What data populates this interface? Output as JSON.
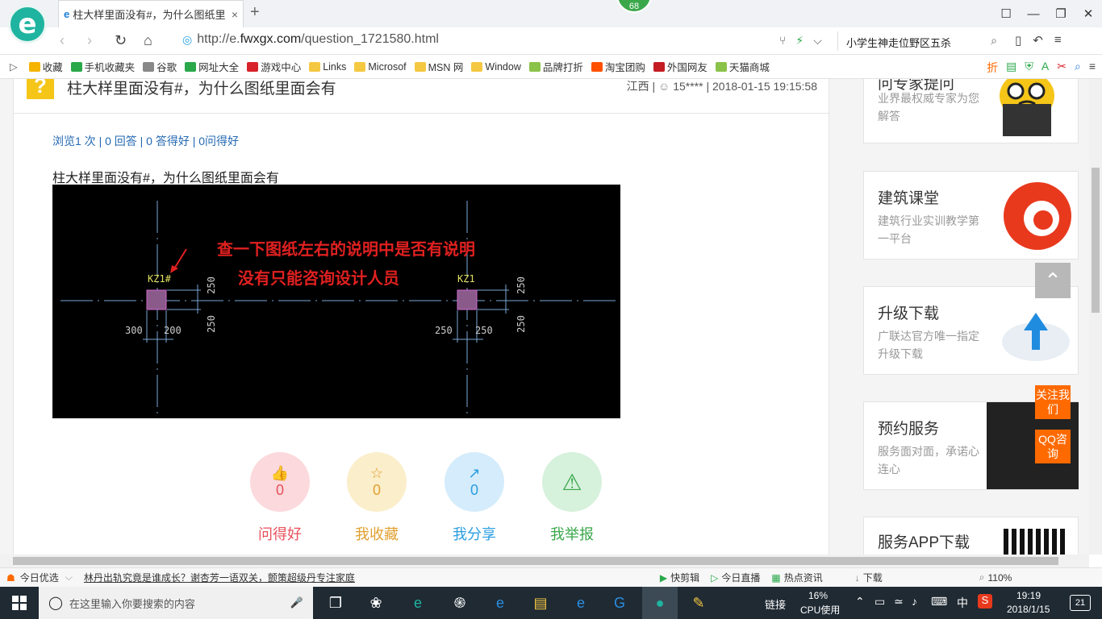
{
  "browser": {
    "tab_title": "柱大样里面没有#，为什么图纸里",
    "tab_close": "×",
    "new_tab": "+",
    "badge": "68",
    "url_prefix": "http://e.",
    "url_domain": "fwxgx.com",
    "url_path": "/question_1721580.html",
    "search_text": "小学生神走位野区五杀",
    "window_controls": [
      "☐",
      "—",
      "❐",
      "✕"
    ]
  },
  "bookmarks": [
    {
      "label": "收藏",
      "color": "#f5b400"
    },
    {
      "label": "手机收藏夹",
      "color": "#2aa84a"
    },
    {
      "label": "谷歌",
      "color": "#888888"
    },
    {
      "label": "网址大全",
      "color": "#2aa84a"
    },
    {
      "label": "游戏中心",
      "color": "#d8232a"
    },
    {
      "label": "Links",
      "color": "#f5c842"
    },
    {
      "label": "Microsof",
      "color": "#f5c842"
    },
    {
      "label": "MSN 网",
      "color": "#f5c842"
    },
    {
      "label": "Window",
      "color": "#f5c842"
    },
    {
      "label": "品牌打折",
      "color": "#8bc34a"
    },
    {
      "label": "淘宝团购",
      "color": "#ff5000"
    },
    {
      "label": "外国网友",
      "color": "#c41d23"
    },
    {
      "label": "天猫商城",
      "color": "#8bc34a"
    }
  ],
  "question": {
    "icon": "?",
    "title": "柱大样里面没有#，为什么图纸里面会有",
    "meta_region": "江西",
    "meta_user": "15****",
    "meta_time": "2018-01-15 19:15:58",
    "stats": "浏览1 次 | 0 回答 | 0 答得好 | 0问得好",
    "body": "柱大样里面没有#，为什么图纸里面会有"
  },
  "drawing": {
    "note_line1": "查一下图纸左右的说明中是否有说明",
    "note_line2": "没有只能咨询设计人员",
    "label_left": "KZ1#",
    "label_right": "KZ1",
    "dim_300": "300",
    "dim_200": "200",
    "dim_250": "250"
  },
  "actions": [
    {
      "label": "问得好",
      "count": "0",
      "color": "#e8505b",
      "bg": "#fbd9dc",
      "icon": "👍"
    },
    {
      "label": "我收藏",
      "count": "0",
      "color": "#e0a030",
      "bg": "#fbeecb",
      "icon": "☆"
    },
    {
      "label": "我分享",
      "count": "0",
      "color": "#2a9ee0",
      "bg": "#d4ecfb",
      "icon": "↗"
    },
    {
      "label": "我举报",
      "count": "",
      "color": "#3aa84a",
      "bg": "#d6f1dc",
      "icon": "⚠"
    }
  ],
  "sidebar": {
    "card1": {
      "title": "问专家提问",
      "sub": "业界最权威专家为您解答"
    },
    "card2": {
      "title": "建筑课堂",
      "sub": "建筑行业实训教学第一平台"
    },
    "card3": {
      "title": "升级下载",
      "sub": "广联达官方唯一指定升级下载"
    },
    "card4": {
      "title": "预约服务",
      "sub": "服务面对面，承诺心连心"
    },
    "card5": {
      "title": "服务APP下载"
    },
    "follow": "关注我们",
    "qq": "QQ咨询"
  },
  "statusbar": {
    "today": "今日优选",
    "news": "林丹出轨究竟是谁成长？谢杏芳一语双关，颤策超级丹专注家庭",
    "items": [
      "快剪辑",
      "今日直播",
      "热点资讯",
      "下载"
    ],
    "zoom": "110%"
  },
  "taskbar": {
    "search_placeholder": "在这里输入你要搜索的内容",
    "link": "链接",
    "cpu_pct": "16%",
    "cpu_label": "CPU使用",
    "ime": "中",
    "time": "19:19",
    "date": "2018/1/15",
    "notif": "21"
  }
}
